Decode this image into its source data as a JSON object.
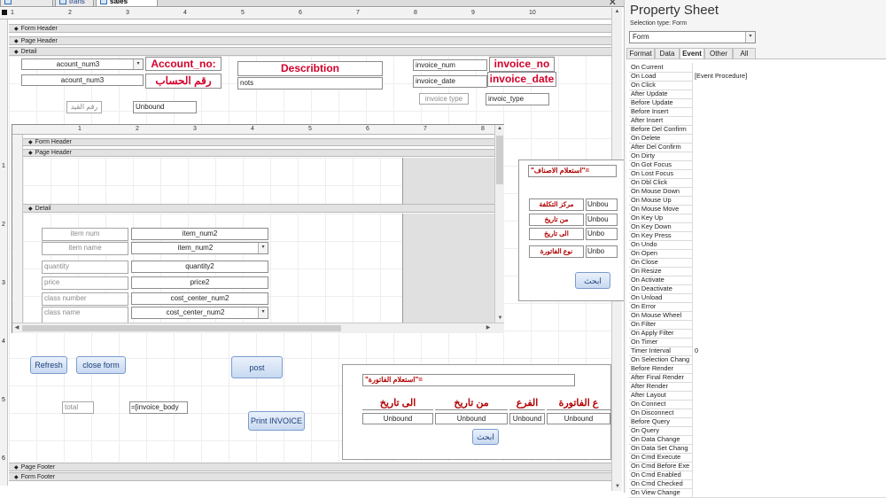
{
  "tabs": [
    "trans_head",
    "trans",
    "sales invoice"
  ],
  "tab_close_glyph": "✕",
  "sections": {
    "form_header": "Form Header",
    "page_header": "Page Header",
    "detail": "Detail",
    "page_footer": "Page Footer",
    "form_footer": "Form Footer"
  },
  "ruler_numbers": [
    "1",
    "2",
    "3",
    "4",
    "5",
    "6",
    "7",
    "8",
    "9",
    "10"
  ],
  "vruler_numbers": [
    "1",
    "2",
    "3",
    "4",
    "5",
    "6"
  ],
  "main": {
    "acount_num3_combo": "acount_num3",
    "acount_num3_label": "acount_num3",
    "account_no_label": "Account_no:",
    "account_arabic_label": "رقم الحساب",
    "describtion_label": "Describtion",
    "nots_field": "nots",
    "invoice_num_field": "invoice_num",
    "invoice_no_label": "invoice_no",
    "invoice_date_field": "invoice_date",
    "invoice_date_label": "invoice_date",
    "invoice_type_label": "invoice type",
    "invoic_type_field": "invoic_type",
    "entry_no_label": "رقم القيد",
    "unbound_field": "Unbound"
  },
  "subform": {
    "form_header": "Form Header",
    "page_header": "Page Header",
    "detail": "Detail",
    "ruler_numbers": [
      "1",
      "2",
      "3",
      "4",
      "5",
      "6",
      "7",
      "8"
    ],
    "rows": [
      {
        "label": "item num",
        "control": "item_num2",
        "combo": false
      },
      {
        "label": "item name",
        "control": "item_num2",
        "combo": true
      },
      {
        "label": "quantity",
        "control": "quantity2",
        "combo": false
      },
      {
        "label": "price",
        "control": "price2",
        "combo": false
      },
      {
        "label": "class number",
        "control": "cost_center_num2",
        "combo": false
      },
      {
        "label": "class name",
        "control": "cost_center_num2",
        "combo": true
      }
    ]
  },
  "side_panel": {
    "query_label": "\"استعلام الاصناف\"=",
    "rows": [
      {
        "label": "مركز التكلفة",
        "value": "Unbou"
      },
      {
        "label": "من تاريخ",
        "value": "Unbou"
      },
      {
        "label": "الى تاريخ",
        "value": "Unbo"
      },
      {
        "label": "نوع الفاتورة",
        "value": "Unbo"
      }
    ],
    "search_button": "ابحث"
  },
  "buttons": {
    "refresh": "Refresh",
    "close_form": "close form",
    "post": "post",
    "print_invoice": "Print INVOICE"
  },
  "totals": {
    "total_label": "total",
    "total_value": "=[invoice_body"
  },
  "invoice_query": {
    "query_label": "\"استعلام الفاتورة\"=",
    "headers": [
      "الى تاريخ",
      "من تاريخ",
      "الفرع",
      "ع الفاتورة"
    ],
    "values": [
      "Unbound",
      "Unbound",
      "Unbound",
      "Unbound"
    ],
    "search_button": "ابحث"
  },
  "property_sheet": {
    "title": "Property Sheet",
    "selection_type": "Selection type:  Form",
    "object": "Form",
    "tabs": [
      "Format",
      "Data",
      "Event",
      "Other",
      "All"
    ],
    "active_tab": "Event",
    "properties": [
      {
        "name": "On Current",
        "value": ""
      },
      {
        "name": "On Load",
        "value": "[Event Procedure]"
      },
      {
        "name": "On Click",
        "value": ""
      },
      {
        "name": "After Update",
        "value": ""
      },
      {
        "name": "Before Update",
        "value": ""
      },
      {
        "name": "Before Insert",
        "value": ""
      },
      {
        "name": "After Insert",
        "value": ""
      },
      {
        "name": "Before Del Confirm",
        "value": ""
      },
      {
        "name": "On Delete",
        "value": ""
      },
      {
        "name": "After Del Confirm",
        "value": ""
      },
      {
        "name": "On Dirty",
        "value": ""
      },
      {
        "name": "On Got Focus",
        "value": ""
      },
      {
        "name": "On Lost Focus",
        "value": ""
      },
      {
        "name": "On Dbl Click",
        "value": ""
      },
      {
        "name": "On Mouse Down",
        "value": ""
      },
      {
        "name": "On Mouse Up",
        "value": ""
      },
      {
        "name": "On Mouse Move",
        "value": ""
      },
      {
        "name": "On Key Up",
        "value": ""
      },
      {
        "name": "On Key Down",
        "value": ""
      },
      {
        "name": "On Key Press",
        "value": ""
      },
      {
        "name": "On Undo",
        "value": ""
      },
      {
        "name": "On Open",
        "value": ""
      },
      {
        "name": "On Close",
        "value": ""
      },
      {
        "name": "On Resize",
        "value": ""
      },
      {
        "name": "On Activate",
        "value": ""
      },
      {
        "name": "On Deactivate",
        "value": ""
      },
      {
        "name": "On Unload",
        "value": ""
      },
      {
        "name": "On Error",
        "value": ""
      },
      {
        "name": "On Mouse Wheel",
        "value": ""
      },
      {
        "name": "On Filter",
        "value": ""
      },
      {
        "name": "On Apply Filter",
        "value": ""
      },
      {
        "name": "On Timer",
        "value": ""
      },
      {
        "name": "Timer Interval",
        "value": "0"
      },
      {
        "name": "On Selection Chang",
        "value": ""
      },
      {
        "name": "Before Render",
        "value": ""
      },
      {
        "name": "After Final Render",
        "value": ""
      },
      {
        "name": "After Render",
        "value": ""
      },
      {
        "name": "After Layout",
        "value": ""
      },
      {
        "name": "On Connect",
        "value": ""
      },
      {
        "name": "On Disconnect",
        "value": ""
      },
      {
        "name": "Before Query",
        "value": ""
      },
      {
        "name": "On Query",
        "value": ""
      },
      {
        "name": "On Data Change",
        "value": ""
      },
      {
        "name": "On Data Set Chang",
        "value": ""
      },
      {
        "name": "On Cmd Execute",
        "value": ""
      },
      {
        "name": "On Cmd Before Exe",
        "value": ""
      },
      {
        "name": "On Cmd Enabled",
        "value": ""
      },
      {
        "name": "On Cmd Checked",
        "value": ""
      },
      {
        "name": "On View Change",
        "value": ""
      }
    ]
  }
}
